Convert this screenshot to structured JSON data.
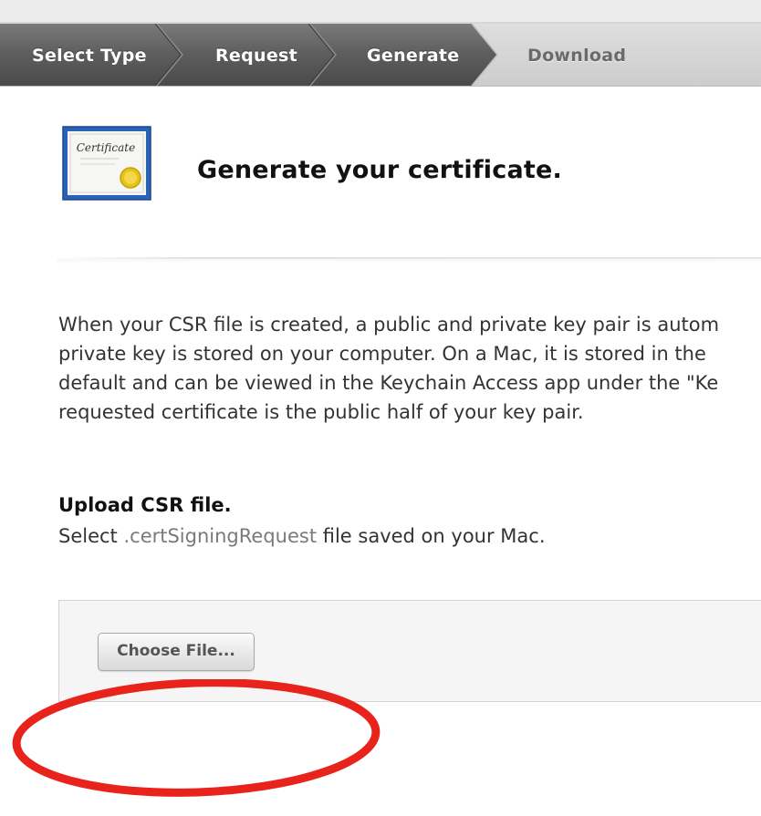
{
  "steps": [
    {
      "label": "Select Type",
      "state": "done"
    },
    {
      "label": "Request",
      "state": "done"
    },
    {
      "label": "Generate",
      "state": "done"
    },
    {
      "label": "Download",
      "state": "current"
    }
  ],
  "header": {
    "icon": "certificate-icon",
    "icon_text": "Certificate",
    "title": "Generate your certificate."
  },
  "description": {
    "lines": [
      "When your CSR file is created, a public and private key pair is autom",
      "private key is stored on your computer. On a Mac, it is stored in the",
      "default and can be viewed in the Keychain Access app under the \"Ke",
      "requested certificate is the public half of your key pair."
    ]
  },
  "upload": {
    "heading": "Upload CSR file.",
    "sub_prefix": "Select ",
    "sub_ext": ".certSigningRequest",
    "sub_suffix": " file saved on your Mac.",
    "button_label": "Choose File..."
  },
  "colors": {
    "step_done_bg": "#555555",
    "step_current_bg": "#d4d4d4",
    "annotation": "#e8231b",
    "cert_border": "#2a63b6"
  }
}
